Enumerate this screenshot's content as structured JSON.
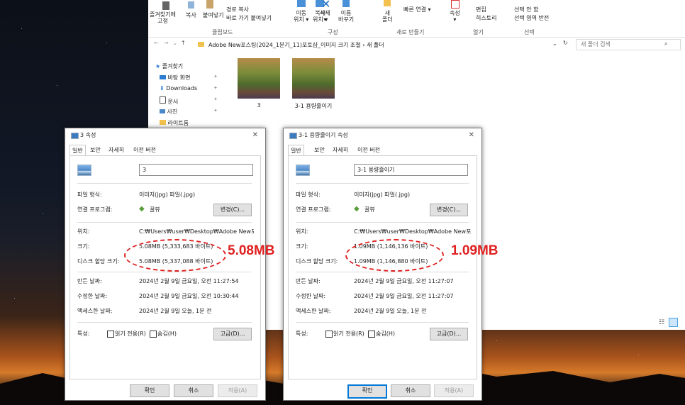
{
  "explorer": {
    "ribbon": {
      "pin_label": "즐겨찾기에\n고정",
      "copy_label": "복사",
      "paste_label": "붙여넣기",
      "copy_path": "경로 복사",
      "paste_shortcut": "바로 가기 붙여넣기",
      "move_label": "이동\n위치 ▾",
      "copyto_label": "복사\n위치 ▾",
      "delete_label": "삭제\n▾",
      "rename_label": "이름\n바꾸기",
      "newfolder_label": "새\n폴더",
      "easy_access": "빠른 연결 ▾",
      "properties_label": "속성\n▾",
      "edit_label": "편집",
      "history_label": "히스토리",
      "select_none": "선택 안 함",
      "invert_select": "선택 영역 반전",
      "group_clipboard": "클립보드",
      "group_organize": "구성",
      "group_new": "새로 만들기",
      "group_open": "열기",
      "group_select": "선택"
    },
    "address_path": "Adobe New포스팅(2024_1분기_11)포토샵_이미지 크기 조절  ›  새 폴더",
    "search_placeholder": "새 폴더 검색",
    "nav": [
      {
        "label": "즐겨찾기",
        "icon": "star-icon"
      },
      {
        "label": "바탕 화면",
        "icon": "desktop-icon"
      },
      {
        "label": "Downloads",
        "icon": "download-icon"
      },
      {
        "label": "문서",
        "icon": "document-icon"
      },
      {
        "label": "사진",
        "icon": "picture-icon"
      },
      {
        "label": "라이트룸",
        "icon": "folder-icon"
      }
    ],
    "files": [
      {
        "name": "3"
      },
      {
        "name": "3-1 용량줄이기"
      }
    ]
  },
  "dialogs": [
    {
      "title": "3 속성",
      "tabs": [
        "일반",
        "보안",
        "자세히",
        "이전 버전"
      ],
      "name_value": "3",
      "file_type_label": "파일 형식:",
      "file_type_value": "이미지(jpg) 파일(.jpg)",
      "open_with_label": "연결 프로그램:",
      "open_with_value": "꿀뷰",
      "change_button": "변경(C)...",
      "location_label": "위치:",
      "location_value": "C:₩Users₩user₩Desktop₩Adobe New포스팅(",
      "size_label": "크기:",
      "size_value": "5.08MB (5,333,683 바이트)",
      "disk_size_label": "디스크 할당 크기:",
      "disk_size_value": "5.08MB (5,337,088 바이트)",
      "created_label": "만든 날짜:",
      "created_value": "2024년 2월 9일 금요일, 오전 11:27:54",
      "modified_label": "수정한 날짜:",
      "modified_value": "2024년 2월 9일 금요일, 오전 10:30:44",
      "accessed_label": "액세스한 날짜:",
      "accessed_value": "2024년 2월 9일 오늘, 1분 전",
      "attributes_label": "특성:",
      "readonly_label": "읽기 전용(R)",
      "hidden_label": "숨김(H)",
      "advanced_button": "고급(D)...",
      "ok_button": "확인",
      "cancel_button": "취소",
      "apply_button": "적용(A)",
      "annotation": "5.08MB"
    },
    {
      "title": "3-1 용량줄이기 속성",
      "tabs": [
        "일반",
        "보안",
        "자세히",
        "이전 버전"
      ],
      "name_value": "3-1 용량줄이기",
      "file_type_label": "파일 형식:",
      "file_type_value": "이미지(jpg) 파일(.jpg)",
      "open_with_label": "연결 프로그램:",
      "open_with_value": "꿀뷰",
      "change_button": "변경(C)...",
      "location_label": "위치:",
      "location_value": "C:₩Users₩user₩Desktop₩Adobe New포스팅(",
      "size_label": "크기:",
      "size_value": "1.09MB (1,146,136 바이트)",
      "disk_size_label": "디스크 할당 크기:",
      "disk_size_value": "1.09MB (1,146,880 바이트)",
      "created_label": "만든 날짜:",
      "created_value": "2024년 2월 9일 금요일, 오전 11:27:07",
      "modified_label": "수정한 날짜:",
      "modified_value": "2024년 2월 9일 금요일, 오전 11:27:07",
      "accessed_label": "액세스한 날짜:",
      "accessed_value": "2024년 2월 9일 오늘, 1분 전",
      "attributes_label": "특성:",
      "readonly_label": "읽기 전용(R)",
      "hidden_label": "숨김(H)",
      "advanced_button": "고급(D)...",
      "ok_button": "확인",
      "cancel_button": "취소",
      "apply_button": "적용(A)",
      "annotation": "1.09MB"
    }
  ],
  "colors": {
    "annotation_red": "#e02020",
    "accent": "#0078d7"
  }
}
